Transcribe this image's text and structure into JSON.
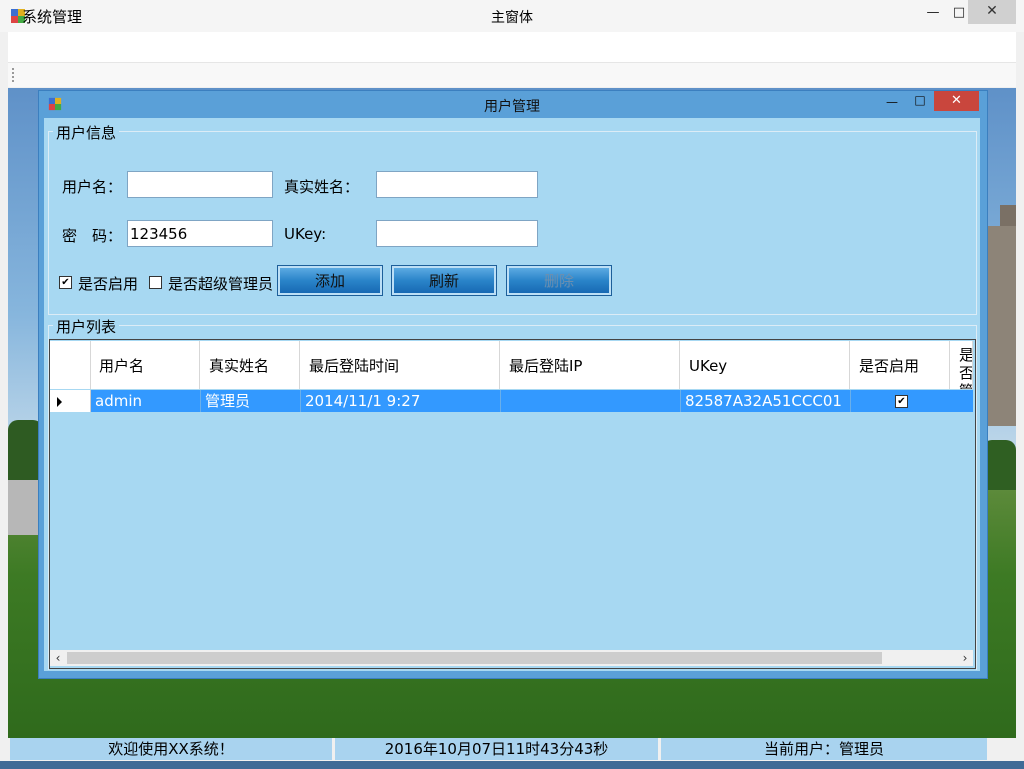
{
  "main_window": {
    "title": "主窗体",
    "menu": [
      "系统管理"
    ],
    "controls": {
      "minimize": "—",
      "maximize": "□",
      "close": "✕"
    }
  },
  "user_window": {
    "title": "用户管理",
    "controls": {
      "minimize": "—",
      "maximize": "□",
      "close": "✕"
    },
    "info_group": {
      "title": "用户信息",
      "username_label": "用户名：",
      "username_value": "",
      "realname_label": "真实姓名：",
      "realname_value": "",
      "password_label": "密　码：",
      "password_value": "123456",
      "ukey_label": "UKey:",
      "ukey_value": "",
      "enabled_label": "是否启用",
      "enabled_checked": true,
      "superadmin_label": "是否超级管理员",
      "superadmin_checked": false,
      "add_button": "添加",
      "refresh_button": "刷新",
      "delete_button": "删除",
      "delete_enabled": false
    },
    "list_group": {
      "title": "用户列表",
      "columns": [
        "用户名",
        "真实姓名",
        "最后登陆时间",
        "最后登陆IP",
        "UKey",
        "是否启用",
        "是否管理"
      ],
      "rows": [
        {
          "username": "admin",
          "realname": "管理员",
          "last_login_time": "2014/11/1 9:27",
          "last_login_ip": "",
          "ukey": "82587A32A51CCC01",
          "enabled": true
        }
      ]
    }
  },
  "status_bar": {
    "welcome": "欢迎使用XX系统！",
    "datetime": "2016年10月07日11时43分43秒",
    "current_user": "当前用户：管理员"
  },
  "colors": {
    "selection": "#3399ff",
    "client_bg": "#a7d8f2",
    "close_red": "#c9463d"
  }
}
